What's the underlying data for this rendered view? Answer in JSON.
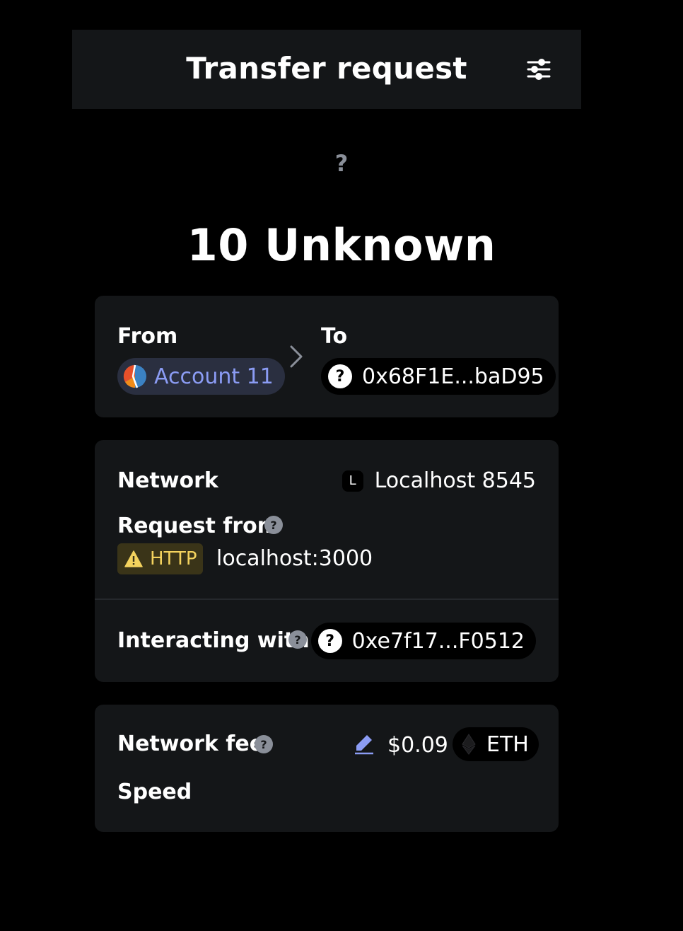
{
  "header": {
    "title": "Transfer request",
    "settings_icon": "sliders-icon"
  },
  "token": {
    "icon_glyph": "?",
    "amount_label": "10 Unknown"
  },
  "transfer": {
    "from_label": "From",
    "to_label": "To",
    "from_account": "Account 11",
    "to_address": "0x68F1E...baD95",
    "to_icon_glyph": "?"
  },
  "details": {
    "network_label": "Network",
    "network_badge": "L",
    "network_name": "Localhost 8545",
    "request_from_label": "Request from",
    "request_badge": "HTTP",
    "request_origin": "localhost:3000",
    "interacting_label": "Interacting with",
    "contract_address": "0xe7f17...F0512",
    "contract_icon_glyph": "?",
    "help_glyph": "?"
  },
  "fee": {
    "network_fee_label": "Network fee",
    "fee_value": "$0.09",
    "fee_currency": "ETH",
    "speed_label": "Speed"
  },
  "colors": {
    "background": "#000000",
    "card": "#141618",
    "accent": "#8b9cf4",
    "warning": "#f4d35e",
    "muted": "#8a8f99"
  }
}
